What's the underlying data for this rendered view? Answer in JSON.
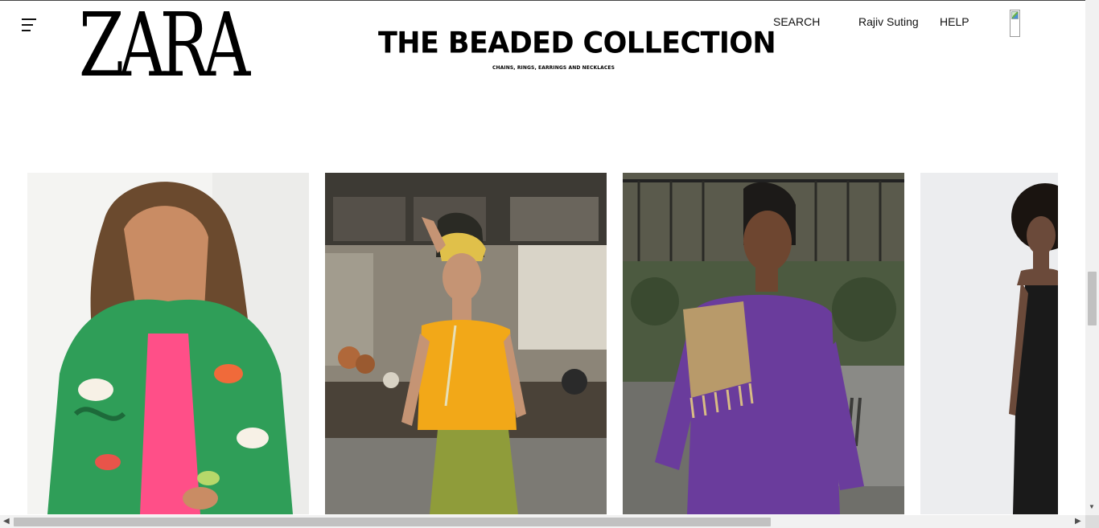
{
  "header": {
    "menu_icon": "hamburger-menu-icon",
    "logo_text": "ZARA",
    "banner": {
      "title": "THE BEADED COLLECTION",
      "subtitle": "CHAINS, RINGS, EARRINGS AND NECKLACES"
    },
    "nav": {
      "search_label": "SEARCH",
      "user_label": "Rajiv Suting",
      "help_label": "HELP"
    },
    "cart_icon": "shopping-bag-icon"
  },
  "gallery": {
    "items": [
      {
        "name": "look-green-floral-shirt",
        "colors": {
          "bg": "#f2f2f0",
          "main": "#2f9e58",
          "accent": "#ff4f88"
        }
      },
      {
        "name": "look-yellow-bandeau-top",
        "colors": {
          "bg": "#5c5850",
          "main": "#f2a818",
          "accent": "#8f9c3a"
        }
      },
      {
        "name": "look-purple-beaded-dress",
        "colors": {
          "bg": "#3f4a37",
          "main": "#6a3c9c",
          "accent": "#b89a6a"
        }
      },
      {
        "name": "look-black-satin-dress",
        "colors": {
          "bg": "#ecedef",
          "main": "#1a1a1a",
          "accent": "#6b4a3a"
        }
      }
    ]
  },
  "scrollbars": {
    "vertical_position": 0.53,
    "horizontal_position": 0
  }
}
